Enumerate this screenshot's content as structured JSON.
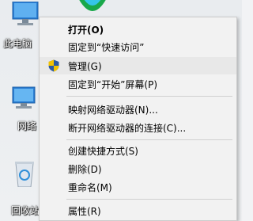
{
  "desktop": {
    "icons": [
      {
        "name": "this-pc",
        "label": "此电脑"
      },
      {
        "name": "network",
        "label": "网络"
      },
      {
        "name": "recycle-bin",
        "label": "回收站"
      }
    ]
  },
  "menu": {
    "items": [
      {
        "key": "open",
        "label": "打开(O)"
      },
      {
        "key": "pin-quick-access",
        "label": "固定到“快速访问”"
      },
      {
        "key": "manage",
        "label": "管理(G)",
        "icon": "uac-shield-icon"
      },
      {
        "key": "pin-start",
        "label": "固定到“开始”屏幕(P)"
      },
      {
        "key": "map-drive",
        "label": "映射网络驱动器(N)..."
      },
      {
        "key": "disconnect-drive",
        "label": "断开网络驱动器的连接(C)..."
      },
      {
        "key": "create-shortcut",
        "label": "创建快捷方式(S)"
      },
      {
        "key": "delete",
        "label": "删除(D)"
      },
      {
        "key": "rename",
        "label": "重命名(M)"
      },
      {
        "key": "properties",
        "label": "属性(R)"
      }
    ]
  }
}
